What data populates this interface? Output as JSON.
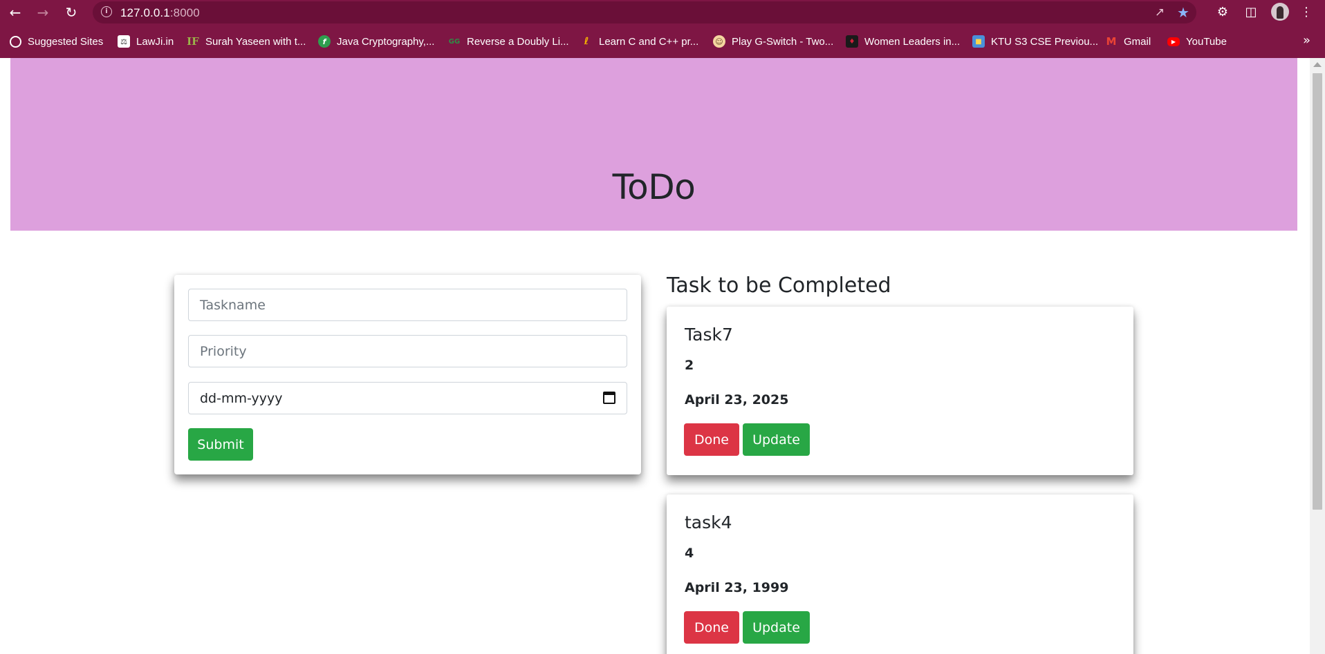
{
  "browser": {
    "url_host": "127.0.0.1",
    "url_port": ":8000",
    "bookmarks": [
      {
        "label": "Suggested Sites",
        "icon": "globe-icon",
        "color": "#ffffff"
      },
      {
        "label": "LawJi.in",
        "icon": "scales-icon",
        "color": "#ffffff"
      },
      {
        "label": "Surah Yaseen with t...",
        "icon": "if-icon",
        "color": "#9bb34a"
      },
      {
        "label": "Java Cryptography,...",
        "icon": "f-leaf-icon",
        "color": "#2e9e4f"
      },
      {
        "label": "Reverse a Doubly Li...",
        "icon": "gfg-icon",
        "color": "#2f8d46"
      },
      {
        "label": "Learn C and C++ pr...",
        "icon": "js-icon",
        "color": "#f7b500"
      },
      {
        "label": "Play G-Switch - Two...",
        "icon": "face-icon",
        "color": "#f4d6a0"
      },
      {
        "label": "Women Leaders in...",
        "icon": "shield-icon",
        "color": "#1a1a1a"
      },
      {
        "label": "KTU S3 CSE Previou...",
        "icon": "book-icon",
        "color": "#4a90d9"
      },
      {
        "label": "Gmail",
        "icon": "gmail-icon",
        "color": "#ea4335"
      },
      {
        "label": "YouTube",
        "icon": "youtube-icon",
        "color": "#ff0000"
      }
    ]
  },
  "page": {
    "title": "ToDo",
    "form": {
      "taskname_placeholder": "Taskname",
      "priority_placeholder": "Priority",
      "date_placeholder": "dd-mm-yyyy",
      "submit_label": "Submit"
    },
    "tasks_heading": "Task to be Completed",
    "tasks": [
      {
        "name": "Task7",
        "priority": "2",
        "due": "April 23, 2025",
        "done_label": "Done",
        "update_label": "Update"
      },
      {
        "name": "task4",
        "priority": "4",
        "due": "April 23, 1999",
        "done_label": "Done",
        "update_label": "Update"
      }
    ]
  },
  "colors": {
    "chrome": "#7e1644",
    "hero": "#dda0dd",
    "success": "#28a745",
    "danger": "#dc3545"
  }
}
